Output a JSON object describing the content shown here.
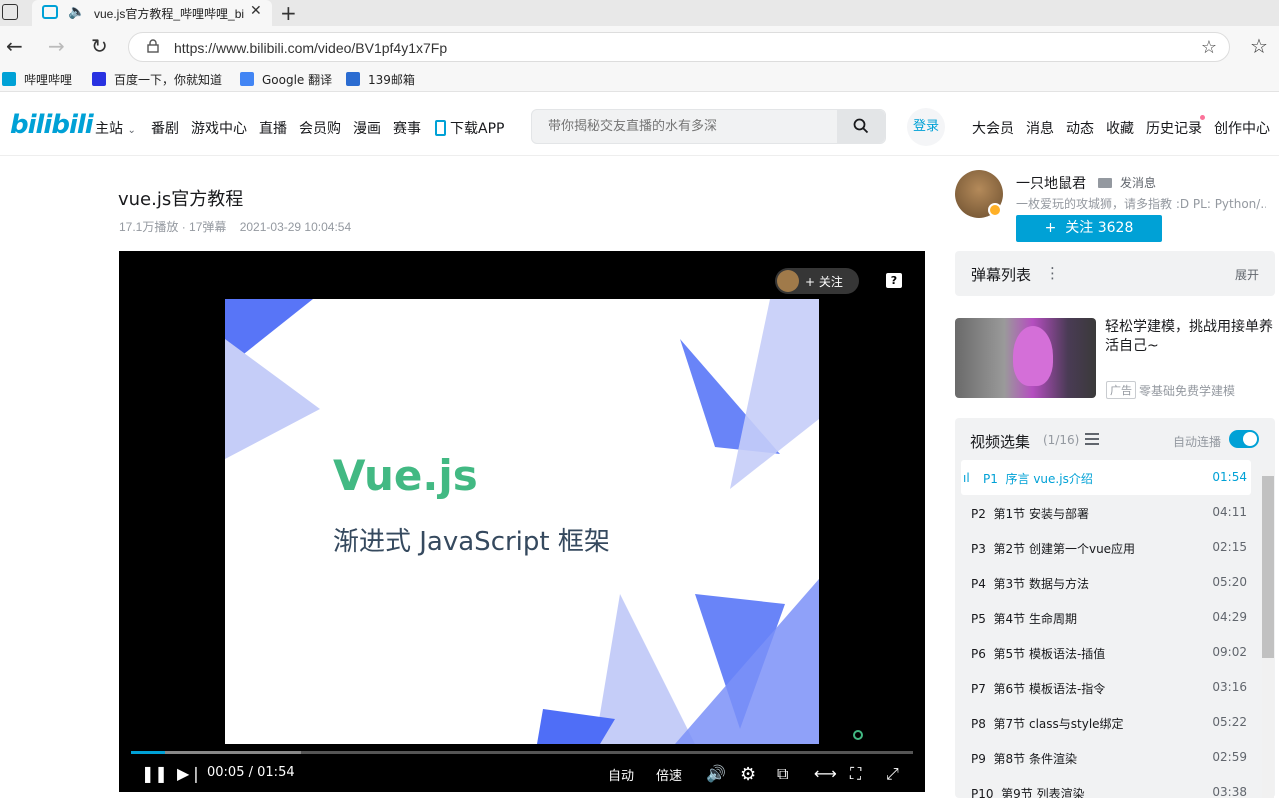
{
  "browser": {
    "tab_title": "vue.js官方教程_哔哩哔哩_bilibili",
    "url": "https://www.bilibili.com/video/BV1pf4y1x7Fp",
    "bookmarks": [
      "哔哩哔哩",
      "百度一下，你就知道",
      "Google 翻译",
      "139邮箱"
    ],
    "bookmark_colors": [
      "#00a1d6",
      "#2932e1",
      "#4285f4",
      "#2b6cd1"
    ]
  },
  "header": {
    "logo": "bilibili",
    "nav_left": [
      "主站",
      "番剧",
      "游戏中心",
      "直播",
      "会员购",
      "漫画",
      "赛事",
      "下载APP"
    ],
    "search_placeholder": "带你揭秘交友直播的水有多深",
    "login": "登录",
    "nav_right": [
      "大会员",
      "消息",
      "动态",
      "收藏",
      "历史记录",
      "创作中心"
    ]
  },
  "video": {
    "title": "vue.js官方教程",
    "meta": "17.1万播放 · 17弹幕    2021-03-29 10:04:54",
    "slide_title": "Vue.js",
    "slide_subtitle": "渐进式 JavaScript 框架",
    "follow_label": "+ 关注",
    "help_label": "?",
    "progress_fraction": 0.044,
    "current_time": "00:05",
    "separator": "/",
    "total_time": "01:54",
    "auto_label": "自动",
    "speed_label": "倍速"
  },
  "uploader": {
    "name": "一只地鼠君",
    "message_label": "发消息",
    "description": "一枚爱玩的攻城狮，请多指教 :D PL: Python/...",
    "follow_button": "+  关注 3628"
  },
  "danmaku": {
    "title": "弹幕列表",
    "more": "⋮",
    "expand": "展开"
  },
  "ad": {
    "title": "轻松学建模，挑战用接单养活自己~",
    "tag": "广告",
    "source": "零基础免费学建模"
  },
  "playlist": {
    "title": "视频选集",
    "count": "(1/16)",
    "autoplay_label": "自动连播",
    "items": [
      {
        "ep": "P1",
        "name": "序言 vue.js介绍",
        "duration": "01:54"
      },
      {
        "ep": "P2",
        "name": "第1节 安装与部署",
        "duration": "04:11"
      },
      {
        "ep": "P3",
        "name": "第2节 创建第一个vue应用",
        "duration": "02:15"
      },
      {
        "ep": "P4",
        "name": "第3节 数据与方法",
        "duration": "05:20"
      },
      {
        "ep": "P5",
        "name": "第4节 生命周期",
        "duration": "04:29"
      },
      {
        "ep": "P6",
        "name": "第5节 模板语法-插值",
        "duration": "09:02"
      },
      {
        "ep": "P7",
        "name": "第6节 模板语法-指令",
        "duration": "03:16"
      },
      {
        "ep": "P8",
        "name": "第7节 class与style绑定",
        "duration": "05:22"
      },
      {
        "ep": "P9",
        "name": "第8节 条件渲染",
        "duration": "02:59"
      },
      {
        "ep": "P10",
        "name": "第9节 列表渲染",
        "duration": "03:38"
      }
    ]
  },
  "colors": {
    "accent": "#00a1d6",
    "vue_green": "#42b983",
    "slide_blue": "#4f6ef7",
    "slide_light": "#c5cdf8"
  }
}
